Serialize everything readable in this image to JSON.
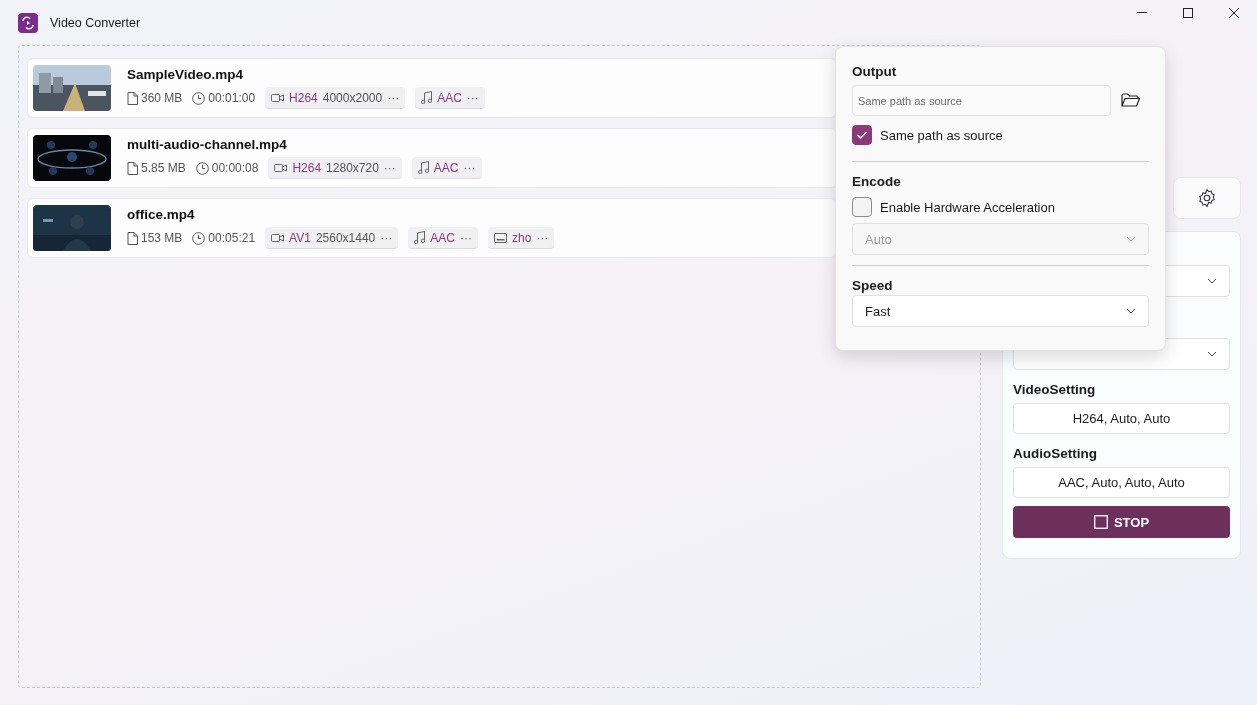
{
  "window": {
    "title": "Video Converter"
  },
  "files": [
    {
      "name": "SampleVideo.mp4",
      "size": "360 MB",
      "duration": "00:01:00",
      "streams": [
        {
          "kind": "video",
          "codec": "H264",
          "detail": "4000x2000",
          "more": "···"
        },
        {
          "kind": "audio",
          "codec": "AAC",
          "more": "···"
        }
      ]
    },
    {
      "name": "multi-audio-channel.mp4",
      "size": "5.85 MB",
      "duration": "00:00:08",
      "streams": [
        {
          "kind": "video",
          "codec": "H264",
          "detail": "1280x720",
          "more": "···"
        },
        {
          "kind": "audio",
          "codec": "AAC",
          "more": "···"
        }
      ]
    },
    {
      "name": "office.mp4",
      "size": "153 MB",
      "duration": "00:05:21",
      "streams": [
        {
          "kind": "video",
          "codec": "AV1",
          "detail": "2560x1440",
          "more": "···"
        },
        {
          "kind": "audio",
          "codec": "AAC",
          "more": "···"
        },
        {
          "kind": "subtitle",
          "codec": "zho",
          "more": "···"
        }
      ]
    }
  ],
  "settings": {
    "video_label": "VideoSetting",
    "video_value": "H264, Auto, Auto",
    "audio_label": "AudioSetting",
    "audio_value": "AAC, Auto, Auto, Auto",
    "stop": "STOP"
  },
  "popup": {
    "output_title": "Output",
    "path_placeholder": "Same path as source",
    "same_path": {
      "label": "Same path as source",
      "checked": true
    },
    "encode_title": "Encode",
    "hw_accel": {
      "label": "Enable Hardware Acceleration",
      "checked": false
    },
    "hw_select": {
      "value": "Auto",
      "disabled": true
    },
    "speed_title": "Speed",
    "speed_select": {
      "value": "Fast",
      "disabled": false
    }
  }
}
